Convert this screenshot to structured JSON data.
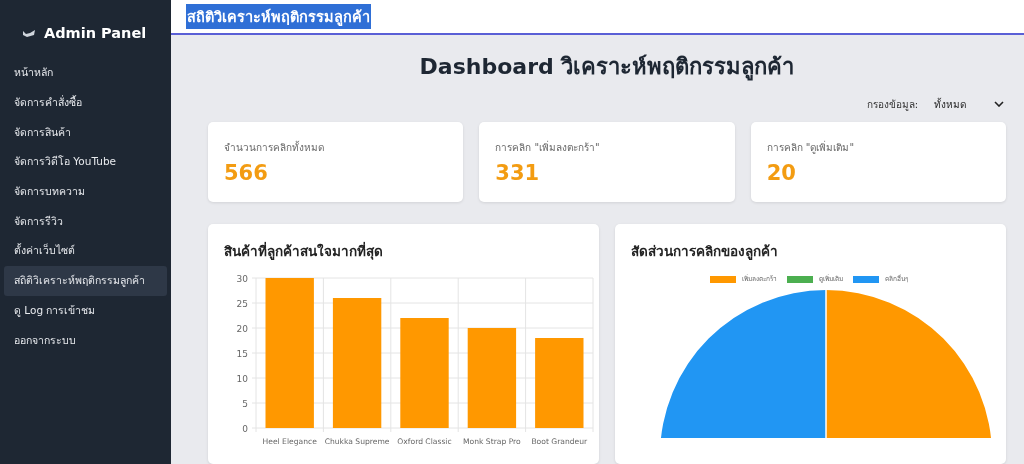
{
  "sidebar": {
    "brand": "Admin Panel",
    "items": [
      {
        "label": "หน้าหลัก",
        "selected": false
      },
      {
        "label": "จัดการคำสั่งซื้อ",
        "selected": false
      },
      {
        "label": "จัดการสินค้า",
        "selected": false
      },
      {
        "label": "จัดการวิดีโอ YouTube",
        "selected": false
      },
      {
        "label": "จัดการบทความ",
        "selected": false
      },
      {
        "label": "จัดการรีวิว",
        "selected": false
      },
      {
        "label": "ตั้งค่าเว็บไซต์",
        "selected": false
      },
      {
        "label": "สถิติวิเคราะห์พฤติกรรมลูกค้า",
        "selected": true
      },
      {
        "label": "ดู Log การเข้าชม",
        "selected": false
      },
      {
        "label": "ออกจากระบบ",
        "selected": false
      }
    ]
  },
  "header": {
    "title": "สถิติวิเคราะห์พฤติกรรมลูกค้า"
  },
  "page_title": "Dashboard วิเคราะห์พฤติกรรมลูกค้า",
  "filter": {
    "label": "กรองข้อมูล:",
    "value": "ทั้งหมด"
  },
  "stats": [
    {
      "label": "จำนวนการคลิกทั้งหมด",
      "value": "566"
    },
    {
      "label": "การคลิก \"เพิ่มลงตะกร้า\"",
      "value": "331"
    },
    {
      "label": "การคลิก \"ดูเพิ่มเติม\"",
      "value": "20"
    }
  ],
  "charts": [
    {
      "kind": "bar",
      "title": "สินค้าที่ลูกค้าสนใจมากที่สุด",
      "chart_data": {
        "type": "bar",
        "categories": [
          "Heel Elegance",
          "Chukka Supreme",
          "Oxford Classic",
          "Monk Strap Pro",
          "Boot Grandeur"
        ],
        "series": [
          {
            "color": "#ff9800",
            "values": [
              30,
              26,
              22,
              20,
              18
            ]
          }
        ],
        "ylim": [
          0,
          30
        ],
        "yticks": [
          0,
          5,
          10,
          15,
          20,
          25,
          30
        ],
        "grid": true
      }
    },
    {
      "kind": "pie",
      "title": "สัดส่วนการคลิกของลูกค้า",
      "legend": [
        {
          "label": "เพิ่มลงตะกร้า",
          "color": "#ff9800"
        },
        {
          "label": "ดูเพิ่มเติม",
          "color": "#4caf50"
        },
        {
          "label": "คลิกอื่นๆ",
          "color": "#2196f3"
        }
      ]
    }
  ]
}
